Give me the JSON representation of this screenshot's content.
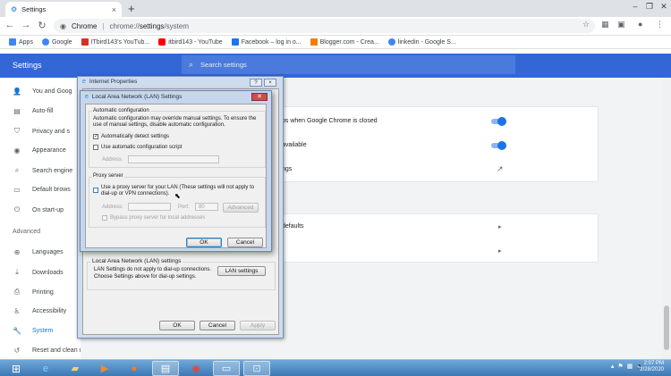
{
  "browser": {
    "tab_title": "Settings",
    "url_host": "Chrome",
    "url_separator": "|",
    "url_prefix": "chrome://",
    "url_path": "settings",
    "url_suffix": "/system",
    "bookmarks": [
      {
        "label": "Apps",
        "icon": "apps-grid-icon",
        "color": "#4285f4"
      },
      {
        "label": "Google",
        "icon": "google-g-icon",
        "color": "#4285f4"
      },
      {
        "label": "ITbird143's YouTub...",
        "icon": "gmail-m-icon",
        "color": "#d93025"
      },
      {
        "label": "itbird143 - YouTube",
        "icon": "youtube-icon",
        "color": "#ff0000"
      },
      {
        "label": "Facebook – log in o...",
        "icon": "facebook-icon",
        "color": "#1877f2"
      },
      {
        "label": "Blogger.com - Crea...",
        "icon": "blogger-icon",
        "color": "#f57d00"
      },
      {
        "label": "linkedin - Google S...",
        "icon": "google-g-icon",
        "color": "#4285f4"
      }
    ]
  },
  "settings": {
    "title": "Settings",
    "search_placeholder": "Search settings",
    "accent": "#3367d6",
    "sidebar": [
      {
        "label": "You and Goog",
        "icon": "person-icon",
        "glyph": "👤"
      },
      {
        "label": "Auto-fill",
        "icon": "clipboard-icon",
        "glyph": "▤"
      },
      {
        "label": "Privacy and s",
        "icon": "shield-icon",
        "glyph": "⛉"
      },
      {
        "label": "Appearance",
        "icon": "palette-icon",
        "glyph": "◉"
      },
      {
        "label": "Search engine",
        "icon": "search-icon",
        "glyph": "⌕"
      },
      {
        "label": "Default brows",
        "icon": "browser-icon",
        "glyph": "▭"
      },
      {
        "label": "On start-up",
        "icon": "power-icon",
        "glyph": "⏻"
      }
    ],
    "advanced_label": "Advanced",
    "advanced_items": [
      {
        "label": "Languages",
        "icon": "globe-icon",
        "glyph": "⊕"
      },
      {
        "label": "Downloads",
        "icon": "download-icon",
        "glyph": "⤓"
      },
      {
        "label": "Printing",
        "icon": "printer-icon",
        "glyph": "⎙"
      },
      {
        "label": "Accessibility",
        "icon": "accessibility-icon",
        "glyph": "♿"
      },
      {
        "label": "System",
        "icon": "wrench-icon",
        "glyph": "🔧",
        "active": true
      },
      {
        "label": "Reset and clean up",
        "icon": "reset-icon",
        "glyph": "↺"
      }
    ],
    "content_rows": [
      "ps when Google Chrome is closed",
      "available",
      "ngs",
      "defaults"
    ]
  },
  "internet_properties": {
    "title": "Internet Properties",
    "lan_group_label": "Local Area Network (LAN) settings",
    "lan_desc": "LAN Settings do not apply to dial-up connections. Choose Settings above for dial-up settings.",
    "lan_settings_button": "LAN settings",
    "ok": "OK",
    "cancel": "Cancel",
    "apply": "Apply"
  },
  "lan_dialog": {
    "title": "Local Area Network (LAN) Settings",
    "auto_group": "Automatic configuration",
    "auto_desc": "Automatic configuration may override manual settings. To ensure the use of manual settings, disable automatic configuration.",
    "auto_detect_label": "Automatically detect settings",
    "auto_detect_checked": true,
    "auto_script_label": "Use automatic configuration script",
    "auto_script_checked": false,
    "address_label": "Address",
    "proxy_group": "Proxy server",
    "proxy_label": "Use a proxy server for your LAN (These settings will not apply to dial-up or VPN connections).",
    "proxy_checked": false,
    "proxy_address_label": "Address:",
    "port_label": "Port:",
    "port_value": "80",
    "advanced_button": "Advanced",
    "bypass_label": "Bypass proxy server for local addresses",
    "ok": "OK",
    "cancel": "Cancel"
  },
  "taskbar": {
    "time": "2:07 PM",
    "date": "2/28/2020"
  }
}
